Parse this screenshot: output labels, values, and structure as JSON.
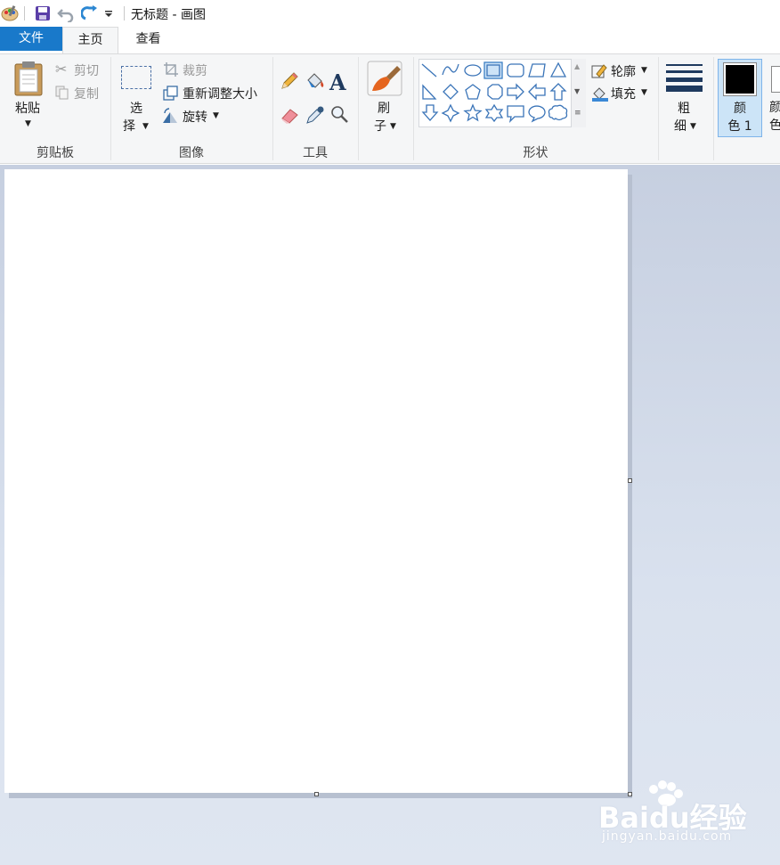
{
  "window": {
    "title": "无标题 - 画图"
  },
  "tabs": {
    "file": "文件",
    "home": "主页",
    "view": "查看"
  },
  "clipboard": {
    "group_label": "剪贴板",
    "paste": "粘贴",
    "cut": "剪切",
    "copy": "复制"
  },
  "image": {
    "group_label": "图像",
    "select_line1": "选",
    "select_line2": "择",
    "crop": "裁剪",
    "resize": "重新调整大小",
    "rotate": "旋转"
  },
  "tools": {
    "group_label": "工具"
  },
  "brushes": {
    "line1": "刷",
    "line2": "子"
  },
  "shapes": {
    "group_label": "形状",
    "outline": "轮廓",
    "fill": "填充"
  },
  "size": {
    "line1": "粗",
    "line2": "细"
  },
  "color1": {
    "line1": "颜",
    "line2": "色 1",
    "swatch": "#000000"
  },
  "color2": {
    "line1": "颜",
    "line2": "色"
  },
  "colors": {
    "accent": "#1979ca",
    "ribbon": "#f5f6f7",
    "workarea": "#c6cfe0"
  },
  "watermark": {
    "brand": "Baidu经验",
    "url": "jingyan.baidu.com"
  }
}
